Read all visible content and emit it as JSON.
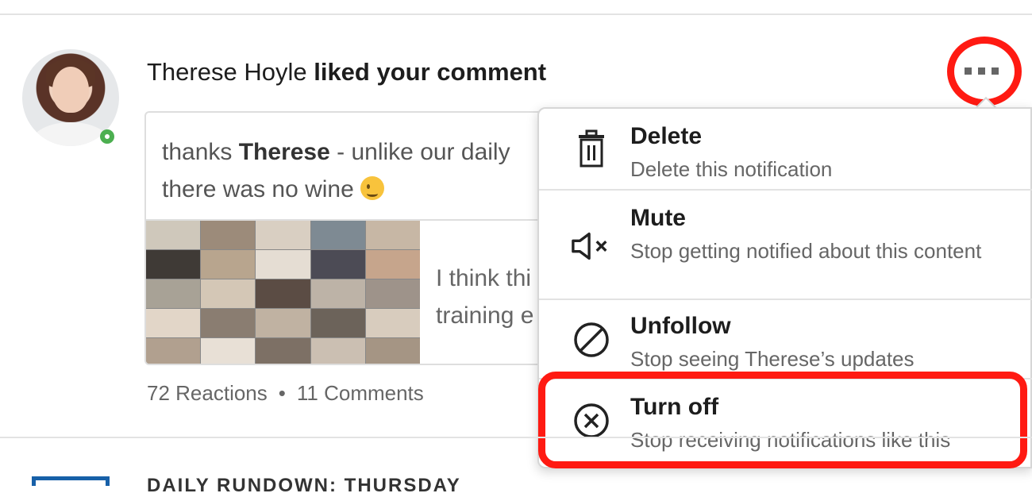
{
  "notification": {
    "actor": "Therese Hoyle",
    "action": "liked your comment",
    "comment_prefix": "thanks ",
    "comment_bold": "Therese",
    "comment_line1_rest": " - unlike our daily",
    "comment_line2": "there was no wine",
    "preview_line1": "I think thi",
    "preview_line2": "training e",
    "reactions": "72 Reactions",
    "bullet": "•",
    "comments": "11 Comments"
  },
  "menu": {
    "items": [
      {
        "title": "Delete",
        "desc": "Delete this notification",
        "icon": "trash-icon"
      },
      {
        "title": "Mute",
        "desc": "Stop getting notified about this content",
        "icon": "mute-icon"
      },
      {
        "title": "Unfollow",
        "desc": "Stop seeing Therese’s updates",
        "icon": "block-icon"
      },
      {
        "title": "Turn off",
        "desc": "Stop receiving notifications like this",
        "icon": "circle-x-icon"
      }
    ]
  },
  "next_notification": {
    "title_partial": "DAILY RUNDOWN: THURSDAY"
  },
  "colors": {
    "highlight": "#ff1a12",
    "online": "#4caf50",
    "brand": "#1760a8"
  }
}
